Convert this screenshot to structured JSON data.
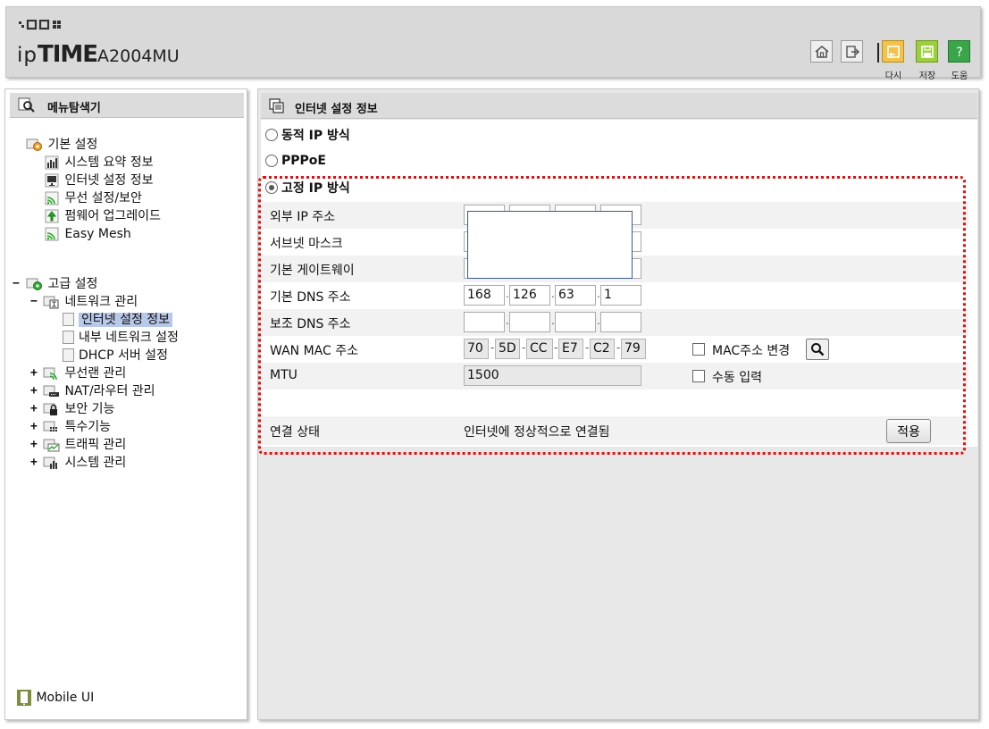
{
  "header": {
    "brand_ip": "ip",
    "brand_time": "TIME",
    "model": "A2004MU",
    "buttons": [
      {
        "name": "home",
        "label": ""
      },
      {
        "name": "logout",
        "label": ""
      },
      {
        "name": "retry",
        "label": "다시"
      },
      {
        "name": "save",
        "label": "저장"
      },
      {
        "name": "help",
        "label": "도움"
      }
    ]
  },
  "sidebar": {
    "title": "메뉴탐색기",
    "basic": {
      "label": "기본 설정",
      "items": [
        "시스템 요약 정보",
        "인터넷 설정 정보",
        "무선 설정/보안",
        "펌웨어 업그레이드",
        "Easy Mesh"
      ]
    },
    "advanced": {
      "toggle": "−",
      "label": "고급 설정",
      "network": {
        "toggle": "−",
        "label": "네트워크 관리",
        "items": [
          "인터넷 설정 정보",
          "내부 네트워크 설정",
          "DHCP 서버 설정"
        ]
      },
      "groups": [
        "무선랜 관리",
        "NAT/라우터 관리",
        "보안 기능",
        "특수기능",
        "트래픽 관리",
        "시스템 관리"
      ]
    },
    "mobile": "Mobile UI"
  },
  "main": {
    "title": "인터넷 설정 정보",
    "modes": [
      {
        "label": "동적 IP 방식",
        "selected": false
      },
      {
        "label": "PPPoE",
        "selected": false
      },
      {
        "label": "고정 IP 방식",
        "selected": true
      }
    ],
    "fields": {
      "external_ip": {
        "label": "외부 IP 주소"
      },
      "subnet": {
        "label": "서브넷 마스크"
      },
      "gateway": {
        "label": "기본 게이트웨이"
      },
      "dns": {
        "label": "기본 DNS 주소",
        "octets": [
          "168",
          "126",
          "63",
          "1"
        ]
      },
      "dns2": {
        "label": "보조 DNS 주소",
        "octets": [
          "",
          "",
          "",
          ""
        ]
      },
      "wan_mac": {
        "label": "WAN MAC 주소",
        "octets": [
          "70",
          "5D",
          "CC",
          "E7",
          "C2",
          "79"
        ],
        "change_label": "MAC주소 변경"
      },
      "mtu": {
        "label": "MTU",
        "value": "1500",
        "manual_label": "수동 입력"
      },
      "status": {
        "label": "연결 상태",
        "value": "인터넷에 정상적으로 연결됨",
        "apply": "적용"
      }
    }
  }
}
